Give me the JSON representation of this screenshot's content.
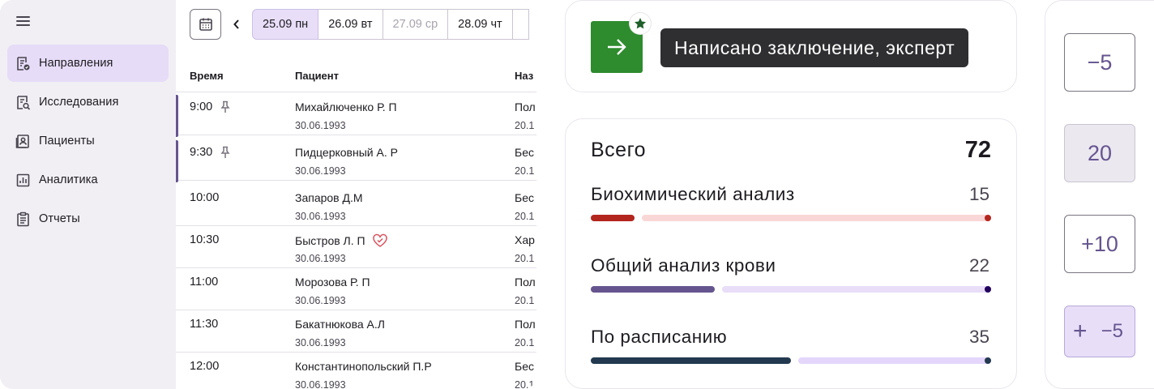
{
  "sidebar": {
    "items": [
      {
        "label": "Направления",
        "icon": "directions-doc-icon",
        "active": true
      },
      {
        "label": "Исследования",
        "icon": "research-search-icon",
        "active": false
      },
      {
        "label": "Пациенты",
        "icon": "patient-card-icon",
        "active": false
      },
      {
        "label": "Аналитика",
        "icon": "analytics-chart-icon",
        "active": false
      },
      {
        "label": "Отчеты",
        "icon": "clipboard-report-icon",
        "active": false
      }
    ]
  },
  "dates": [
    {
      "label": "25.09 пн",
      "state": "selected"
    },
    {
      "label": "26.09 вт",
      "state": "normal"
    },
    {
      "label": "27.09 ср",
      "state": "disabled"
    },
    {
      "label": "28.09 чт",
      "state": "normal"
    }
  ],
  "table": {
    "headers": {
      "time": "Время",
      "patient": "Пациент",
      "destination": "Наз"
    },
    "rows": [
      {
        "time": "9:00",
        "name": "Михайлюченко Р. П",
        "dob": "30.06.1993",
        "dest": "Пол",
        "dest_date": "20.1"
      },
      {
        "time": "9:30",
        "name": "Пидцерковный А. Р",
        "dob": "30.06.1993",
        "dest": "Бес",
        "dest_date": "20.1"
      },
      {
        "time": "10:00",
        "name": "Запаров Д.М",
        "dob": "30.06.1993",
        "dest": "Бес",
        "dest_date": "20.1"
      },
      {
        "time": "10:30",
        "name": "Быстров Л. П",
        "dob": "30.06.1993",
        "dest": "Хар",
        "dest_date": "20.1"
      },
      {
        "time": "11:00",
        "name": "Морозова Р. П",
        "dob": "30.06.1993",
        "dest": "Пол",
        "dest_date": "20.1"
      },
      {
        "time": "11:30",
        "name": "Бакатнюкова А.Л",
        "dob": "30.06.1993",
        "dest": "Пол",
        "dest_date": "20.1"
      },
      {
        "time": "12:00",
        "name": "Константинопольский П.Р",
        "dob": "30.06.1993",
        "dest": "Бес",
        "dest_date": "20.1"
      }
    ]
  },
  "status": {
    "tooltip": "Написано заключение, эксперт",
    "icon_color": "#2e8b2e"
  },
  "stats": {
    "total_label": "Всего",
    "total_value": "72",
    "items": [
      {
        "label": "Биохимический анализ",
        "value": "15",
        "fill": 0.11,
        "active_color": "#b3261e",
        "track_color": "#f9d7d6",
        "stop_color": "#b3261e"
      },
      {
        "label": "Общий анализ крови",
        "value": "22",
        "fill": 0.31,
        "active_color": "#65558f",
        "track_color": "#e8def8",
        "stop_color": "#21005d"
      },
      {
        "label": "По расписанию",
        "value": "35",
        "fill": 0.5,
        "active_color": "#23394f",
        "track_color": "#e4d6fb",
        "stop_color": "#23394f"
      }
    ]
  },
  "stepper": {
    "minus_label": "−5",
    "value": "20",
    "plus_label": "+10",
    "hover_plus": "+",
    "hover_minus": "−5"
  }
}
